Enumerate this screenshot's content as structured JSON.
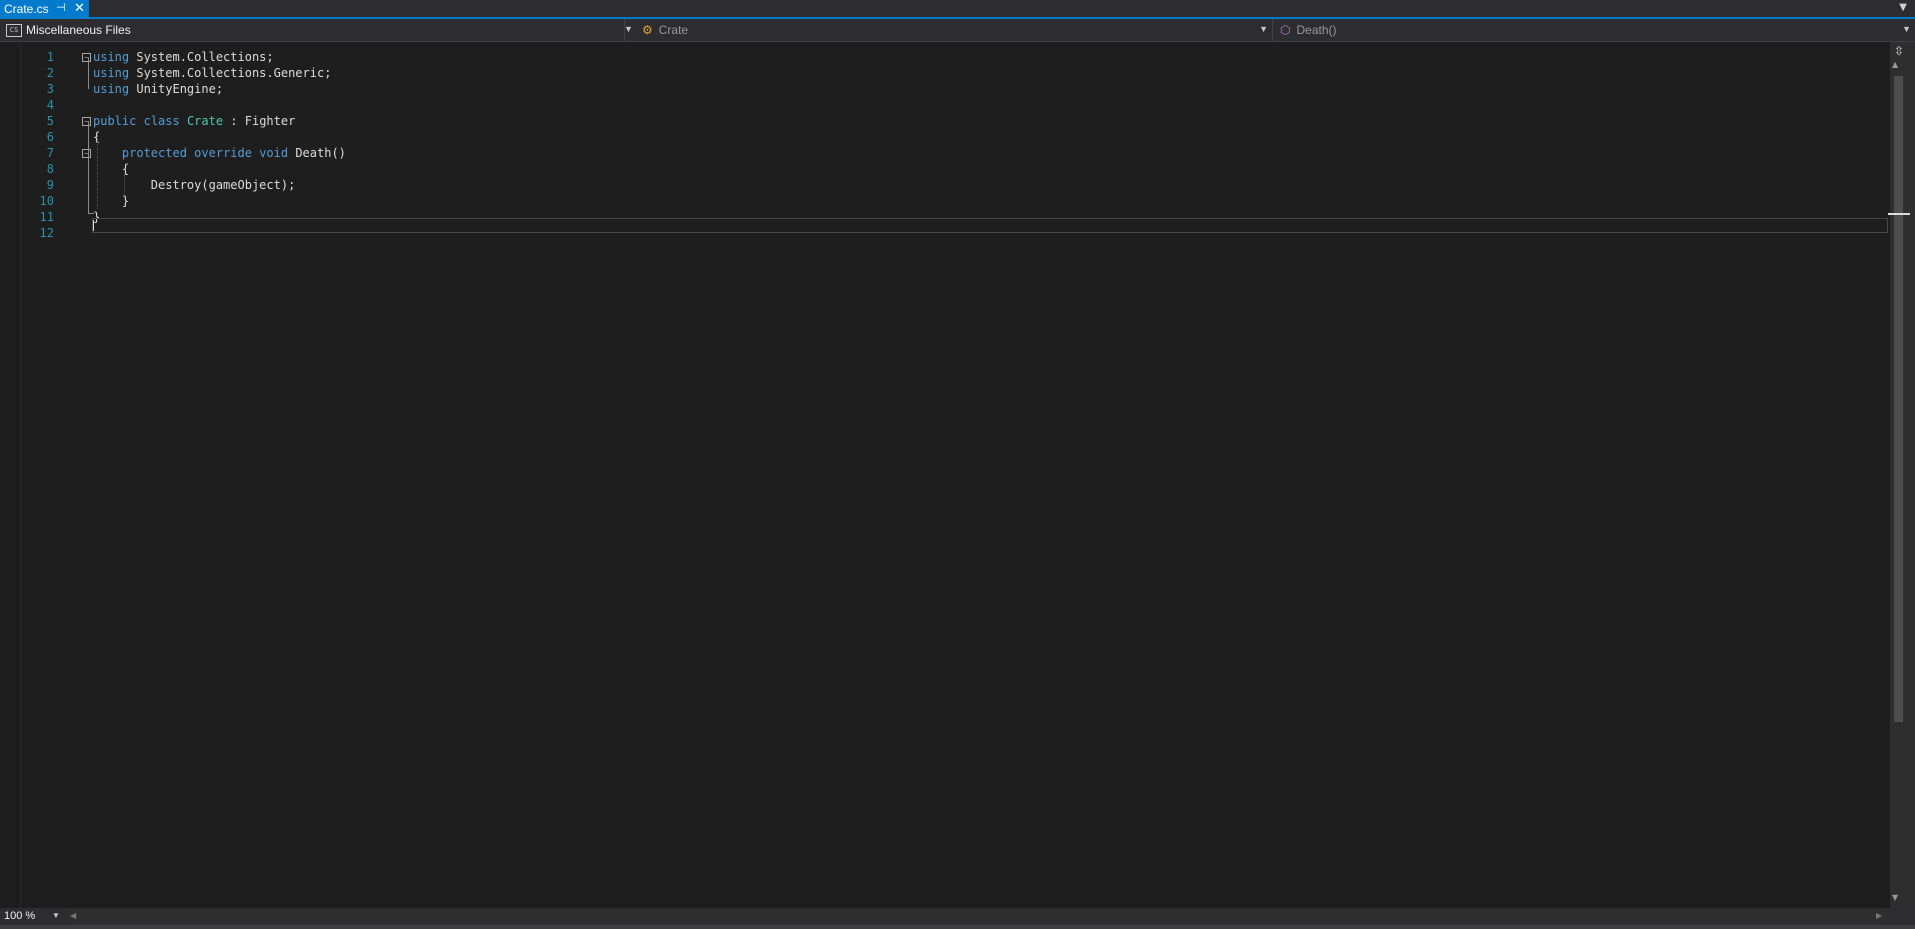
{
  "tab": {
    "title": "Crate.cs",
    "pin_icon": "pin-icon",
    "close_icon": "close-icon"
  },
  "navbar": {
    "project": "Miscellaneous Files",
    "project_icon": "CS",
    "class": "Crate",
    "member": "Death()"
  },
  "code": {
    "line_numbers": [
      "1",
      "2",
      "3",
      "4",
      "5",
      "6",
      "7",
      "8",
      "9",
      "10",
      "11",
      "12"
    ],
    "lines": [
      [
        {
          "t": "using",
          "c": "kw"
        },
        {
          "t": " System.Collections;"
        }
      ],
      [
        {
          "t": "using",
          "c": "kw"
        },
        {
          "t": " System.Collections.Generic;"
        }
      ],
      [
        {
          "t": "using",
          "c": "kw"
        },
        {
          "t": " UnityEngine;"
        }
      ],
      [],
      [
        {
          "t": "public",
          "c": "kw"
        },
        {
          "t": " "
        },
        {
          "t": "class",
          "c": "kw"
        },
        {
          "t": " "
        },
        {
          "t": "Crate",
          "c": "type"
        },
        {
          "t": " : Fighter"
        }
      ],
      [
        {
          "t": "{"
        }
      ],
      [
        {
          "t": "    "
        },
        {
          "t": "protected",
          "c": "kw"
        },
        {
          "t": " "
        },
        {
          "t": "override",
          "c": "kw"
        },
        {
          "t": " "
        },
        {
          "t": "void",
          "c": "kw"
        },
        {
          "t": " Death()"
        }
      ],
      [
        {
          "t": "    {"
        }
      ],
      [
        {
          "t": "        Destroy(gameObject);"
        }
      ],
      [
        {
          "t": "    }"
        }
      ],
      [
        {
          "t": "}"
        }
      ],
      []
    ]
  },
  "status": {
    "zoom": "100 %"
  },
  "colors": {
    "accent": "#007acc",
    "keyword": "#569cd6",
    "type": "#4ec9b0",
    "line_number": "#2b91af"
  }
}
